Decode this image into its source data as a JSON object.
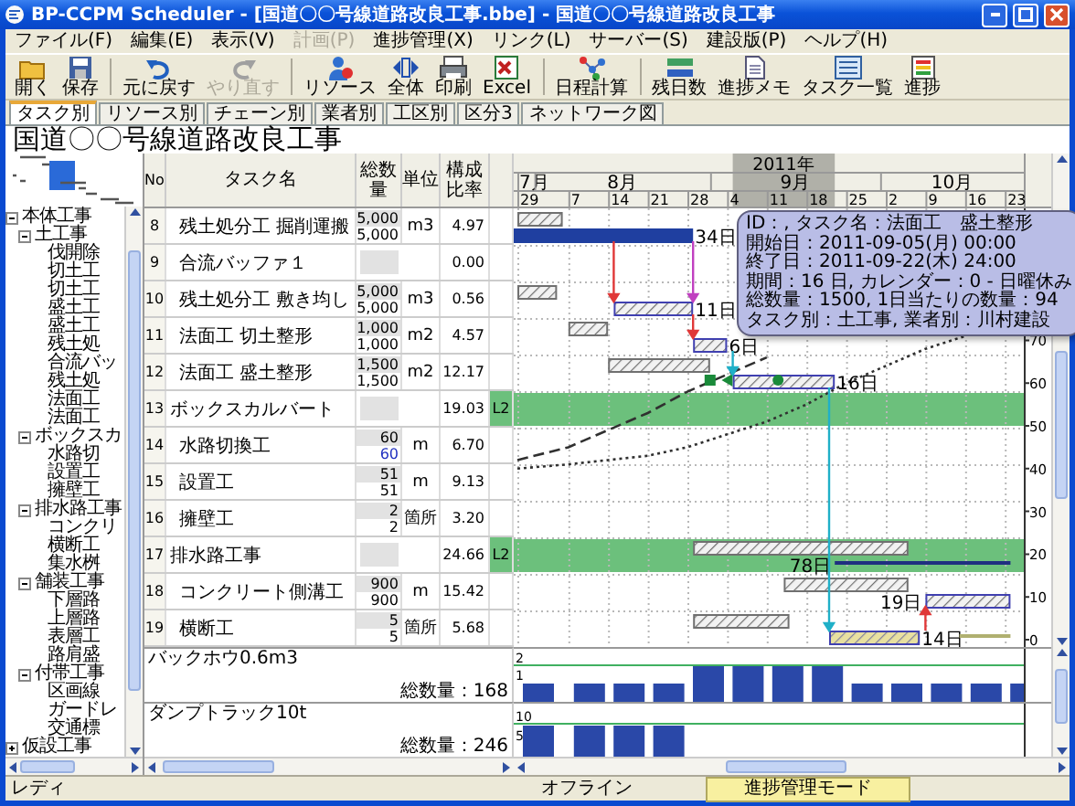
{
  "window": {
    "title": "BP-CCPM Scheduler - [国道〇〇号線道路改良工事.bbe] - 国道〇〇号線道路改良工事"
  },
  "menu": [
    {
      "label": "ファイル(F)",
      "disabled": false
    },
    {
      "label": "編集(E)",
      "disabled": false
    },
    {
      "label": "表示(V)",
      "disabled": false
    },
    {
      "label": "計画(P)",
      "disabled": true
    },
    {
      "label": "進捗管理(X)",
      "disabled": false
    },
    {
      "label": "リンク(L)",
      "disabled": false
    },
    {
      "label": "サーバー(S)",
      "disabled": false
    },
    {
      "label": "建設版(P)",
      "disabled": false
    },
    {
      "label": "ヘルプ(H)",
      "disabled": false
    }
  ],
  "toolbar": [
    {
      "label": "開く",
      "kind": "open",
      "disabled": false,
      "separator_before": false
    },
    {
      "label": "保存",
      "kind": "save",
      "disabled": false,
      "separator_before": false
    },
    {
      "label": "元に戻す",
      "kind": "undo",
      "disabled": false,
      "separator_before": true
    },
    {
      "label": "やり直す",
      "kind": "redo",
      "disabled": true,
      "separator_before": false
    },
    {
      "label": "リソース",
      "kind": "resource",
      "disabled": false,
      "separator_before": true
    },
    {
      "label": "全体",
      "kind": "fit",
      "disabled": false,
      "separator_before": false
    },
    {
      "label": "印刷",
      "kind": "print",
      "disabled": false,
      "separator_before": false
    },
    {
      "label": "Excel",
      "kind": "excel",
      "disabled": false,
      "separator_before": false
    },
    {
      "label": "日程計算",
      "kind": "schedule",
      "disabled": false,
      "separator_before": true
    },
    {
      "label": "残日数",
      "kind": "remaining",
      "disabled": false,
      "separator_before": true
    },
    {
      "label": "進捗メモ",
      "kind": "memo",
      "disabled": false,
      "separator_before": false
    },
    {
      "label": "タスク一覧",
      "kind": "list",
      "disabled": false,
      "separator_before": false
    },
    {
      "label": "進捗",
      "kind": "progress",
      "disabled": false,
      "separator_before": false
    }
  ],
  "tabs": [
    {
      "label": "タスク別",
      "selected": true
    },
    {
      "label": "リソース別",
      "selected": false
    },
    {
      "label": "チェーン別",
      "selected": false
    },
    {
      "label": "業者別",
      "selected": false
    },
    {
      "label": "工区別",
      "selected": false
    },
    {
      "label": "区分3",
      "selected": false
    },
    {
      "label": "ネットワーク図",
      "selected": false
    }
  ],
  "project_title": "国道〇〇号線道路改良工事",
  "tree": [
    {
      "label": "本体工事",
      "expanded": true,
      "children": [
        {
          "label": "土工事",
          "expanded": true,
          "children": [
            {
              "label": "伐開除"
            },
            {
              "label": "切土工"
            },
            {
              "label": "切土工"
            },
            {
              "label": "盛土工"
            },
            {
              "label": "盛土工"
            },
            {
              "label": "残土処"
            },
            {
              "label": "合流バッ"
            },
            {
              "label": "残土処"
            },
            {
              "label": "法面工"
            },
            {
              "label": "法面工"
            }
          ]
        },
        {
          "label": "ボックスカ",
          "expanded": true,
          "children": [
            {
              "label": "水路切"
            },
            {
              "label": "設置工"
            },
            {
              "label": "擁壁工"
            }
          ]
        },
        {
          "label": "排水路工事",
          "expanded": true,
          "children": [
            {
              "label": "コンクリ"
            },
            {
              "label": "横断工"
            },
            {
              "label": "集水桝"
            }
          ]
        },
        {
          "label": "舗装工事",
          "expanded": true,
          "children": [
            {
              "label": "下層路"
            },
            {
              "label": "上層路"
            },
            {
              "label": "表層工"
            },
            {
              "label": "路肩盛"
            }
          ]
        },
        {
          "label": "付帯工事",
          "expanded": true,
          "children": [
            {
              "label": "区画線"
            },
            {
              "label": "ガードレ"
            },
            {
              "label": "交通標"
            }
          ]
        }
      ]
    },
    {
      "label": "仮設工事",
      "expanded": false
    }
  ],
  "table": {
    "columns": [
      "No",
      "タスク名",
      "総数量",
      "単位",
      "構成比率"
    ],
    "rows": [
      {
        "no": "8",
        "name": "残土処分工 掘削運搬",
        "quantity": [
          "5,000",
          "5,000"
        ],
        "unit": "m3",
        "ratio": "4.97",
        "summary": false,
        "bars": [
          {
            "kind": "plan"
          },
          {
            "kind": "actual",
            "label": "34日"
          }
        ],
        "links": [
          {
            "color": "#e03838"
          },
          {
            "color": "#c040c0"
          }
        ]
      },
      {
        "no": "9",
        "name": "合流バッファ１",
        "ratio": "0.00",
        "summary": false,
        "bars": []
      },
      {
        "no": "10",
        "name": "残土処分工 敷き均し",
        "quantity": [
          "5,000",
          "5,000"
        ],
        "unit": "m3",
        "ratio": "0.56",
        "summary": false,
        "bars": [
          {
            "kind": "plan"
          },
          {
            "kind": "current",
            "label": "11日"
          }
        ],
        "links": [
          {
            "color": "#e03838"
          }
        ]
      },
      {
        "no": "11",
        "name": "法面工 切土整形",
        "quantity": [
          "1,000",
          "1,000"
        ],
        "unit": "m2",
        "ratio": "4.57",
        "summary": false,
        "bars": [
          {
            "kind": "plan"
          },
          {
            "kind": "current",
            "label": "6日"
          }
        ],
        "links": [
          {
            "color": "#20b0c8"
          }
        ]
      },
      {
        "no": "12",
        "name": "法面工 盛土整形",
        "quantity": [
          "1,500",
          "1,500"
        ],
        "unit": "m2",
        "ratio": "12.17",
        "summary": false,
        "bars": [
          {
            "kind": "plan"
          },
          {
            "kind": "current",
            "label": "16日"
          }
        ],
        "markers": [
          {
            "kind": "square"
          },
          {
            "kind": "triangle"
          },
          {
            "kind": "circle"
          }
        ],
        "links": [
          {
            "color": "#20b0c8"
          }
        ]
      },
      {
        "no": "13",
        "name": "ボックスカルバート",
        "ratio": "19.03",
        "column_6": "L2",
        "summary": true,
        "bars": []
      },
      {
        "no": "14",
        "name": "水路切換工",
        "quantity": [
          "60",
          "60"
        ],
        "unit": "m",
        "ratio": "6.70",
        "summary": false,
        "edited": true,
        "bars": []
      },
      {
        "no": "15",
        "name": "設置工",
        "quantity": [
          "51",
          "51"
        ],
        "unit": "m",
        "ratio": "9.13",
        "summary": false,
        "bars": []
      },
      {
        "no": "16",
        "name": "擁壁工",
        "quantity": [
          "2",
          "2"
        ],
        "unit": "箇所",
        "ratio": "3.20",
        "summary": false,
        "bars": []
      },
      {
        "no": "17",
        "name": "排水路工事",
        "ratio": "24.66",
        "column_6": "L2",
        "summary": true,
        "bars": [
          {
            "kind": "plan"
          },
          {
            "kind": "remaining",
            "label": "78日"
          }
        ]
      },
      {
        "no": "18",
        "name": "コンクリート側溝工",
        "quantity": [
          "900",
          "900"
        ],
        "unit": "m",
        "ratio": "15.42",
        "summary": false,
        "bars": [
          {
            "kind": "plan"
          },
          {
            "kind": "current",
            "label": "19日"
          }
        ]
      },
      {
        "no": "19",
        "name": "横断工",
        "quantity": [
          "5",
          "5"
        ],
        "unit": "箇所",
        "ratio": "5.68",
        "summary": false,
        "bars": [
          {
            "kind": "plan"
          },
          {
            "kind": "delayed",
            "label": "14日"
          },
          {
            "kind": "slack"
          }
        ],
        "links": [
          {
            "color": "#e03838"
          }
        ]
      }
    ]
  },
  "gantt": {
    "year": "2011年",
    "months": [
      "7月",
      "8月",
      "9月",
      "10月"
    ],
    "weeks": [
      "29",
      "7",
      "14",
      "21",
      "28",
      "4",
      "11",
      "18",
      "25",
      "2",
      "9",
      "16",
      "23"
    ],
    "axis_ticks": [
      "70",
      "60",
      "50",
      "40",
      "30",
      "20",
      "10",
      "0"
    ],
    "tooltip": {
      "lines": [
        "ID：, タスク名：法面工　盛土整形",
        "開始日：2011-09-05(月) 00:00",
        "終了日：2011-09-22(木) 24:00",
        "期間：16 日, カレンダー：0 - 日曜休み",
        "総数量：1500, 1日当たりの数量：94",
        "タスク別：土工事, 業者別：川村建設"
      ]
    }
  },
  "resources": [
    {
      "name": "バックホウ0.6m3",
      "total": "総数量：168",
      "ticks": [
        "2",
        "1"
      ]
    },
    {
      "name": "ダンプトラック10t",
      "total": "総数量：246",
      "ticks": [
        "10",
        "5"
      ]
    }
  ],
  "status_bar": {
    "state": "レディ",
    "connection": "オフライン",
    "mode": "進捗管理モード"
  }
}
